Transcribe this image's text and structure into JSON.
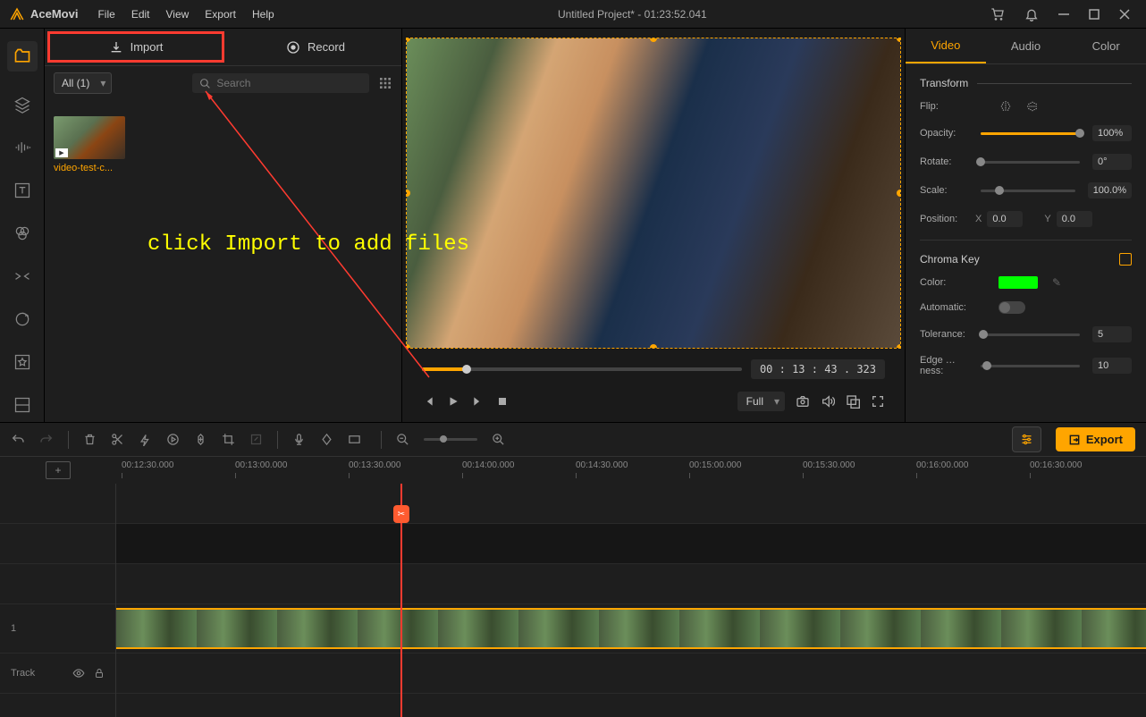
{
  "app": {
    "name": "AceMovi"
  },
  "menu": [
    "File",
    "Edit",
    "View",
    "Export",
    "Help"
  ],
  "title": "Untitled Project* - 01:23:52.041",
  "toolbar": {
    "import_label": "Import",
    "record_label": "Record",
    "filter_label": "All (1)",
    "search_placeholder": "Search"
  },
  "media": {
    "items": [
      {
        "label": "video-test-c..."
      }
    ]
  },
  "annotation": {
    "text": "click Import to add files"
  },
  "preview": {
    "time": "00 : 13 : 43 . 323",
    "view_mode": "Full"
  },
  "props": {
    "tabs": [
      "Video",
      "Audio",
      "Color"
    ],
    "transform": {
      "title": "Transform",
      "flip_label": "Flip:",
      "opacity_label": "Opacity:",
      "opacity_value": "100%",
      "rotate_label": "Rotate:",
      "rotate_value": "0°",
      "scale_label": "Scale:",
      "scale_value": "100.0%",
      "position_label": "Position:",
      "pos_x_label": "X",
      "pos_x_value": "0.0",
      "pos_y_label": "Y",
      "pos_y_value": "0.0"
    },
    "chroma": {
      "title": "Chroma Key",
      "color_label": "Color:",
      "color_value": "#00ff00",
      "auto_label": "Automatic:",
      "tolerance_label": "Tolerance:",
      "tolerance_value": "5",
      "edge_label": "Edge …ness:",
      "edge_value": "10"
    }
  },
  "timeline": {
    "export_label": "Export",
    "ticks": [
      "00:12:30.000",
      "00:13:00.000",
      "00:13:30.000",
      "00:14:00.000",
      "00:14:30.000",
      "00:15:00.000",
      "00:15:30.000",
      "00:16:00.000",
      "00:16:30.000"
    ],
    "track_label": "Track",
    "track_index": "1"
  }
}
